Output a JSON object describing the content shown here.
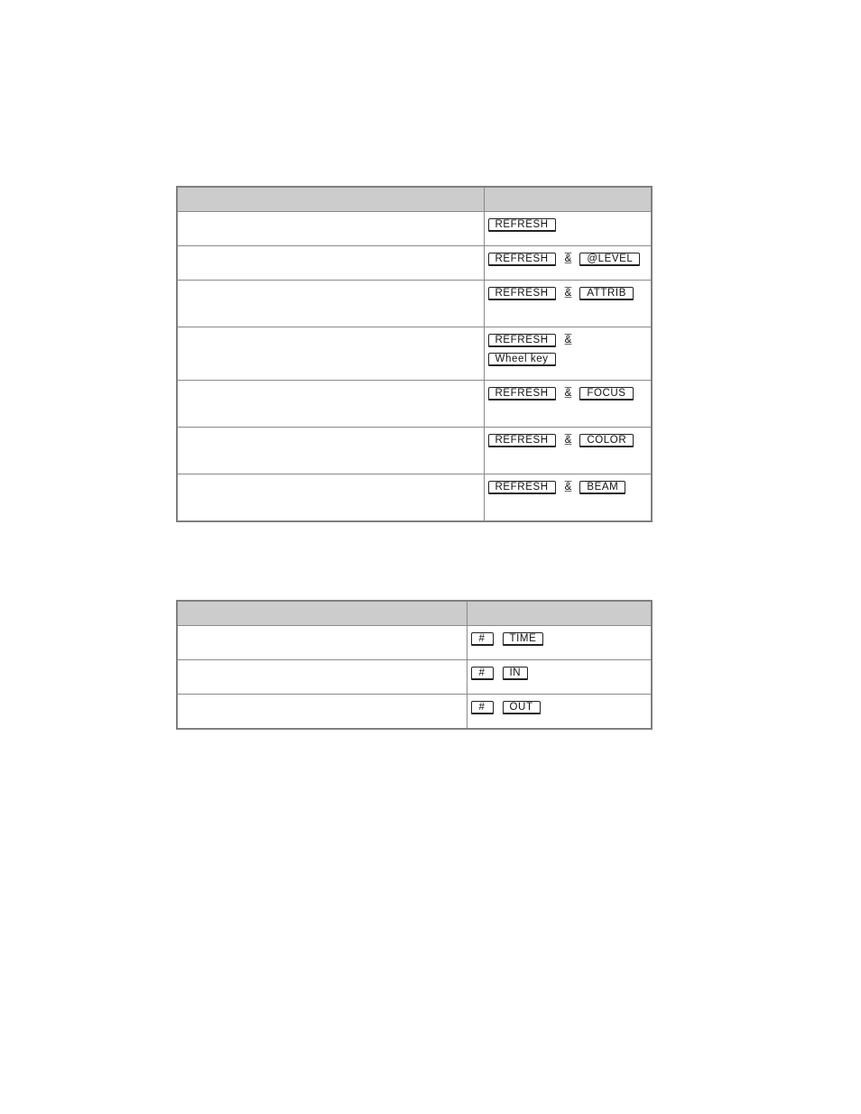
{
  "table1": {
    "header": [
      "",
      ""
    ],
    "rows": [
      {
        "description": "",
        "keys": [
          [
            "REFRESH"
          ]
        ],
        "separator": ""
      },
      {
        "description": "",
        "keys": [
          [
            "REFRESH",
            "&",
            "@LEVEL"
          ]
        ]
      },
      {
        "description": "",
        "keys": [
          [
            "REFRESH",
            "&",
            "ATTRIB"
          ]
        ]
      },
      {
        "description": "",
        "keys": [
          [
            "REFRESH",
            "&"
          ],
          [
            "Wheel key"
          ]
        ]
      },
      {
        "description": "",
        "keys": [
          [
            "REFRESH",
            "&",
            "FOCUS"
          ]
        ]
      },
      {
        "description": "",
        "keys": [
          [
            "REFRESH",
            "&",
            "COLOR"
          ]
        ]
      },
      {
        "description": "",
        "keys": [
          [
            "REFRESH",
            "&",
            "BEAM"
          ]
        ]
      }
    ]
  },
  "table2": {
    "header": [
      "",
      ""
    ],
    "rows": [
      {
        "description": "",
        "keys": [
          [
            "#",
            "TIME"
          ]
        ]
      },
      {
        "description": "",
        "keys": [
          [
            "#",
            "IN"
          ]
        ]
      },
      {
        "description": "",
        "keys": [
          [
            "#",
            "OUT"
          ]
        ]
      }
    ]
  }
}
